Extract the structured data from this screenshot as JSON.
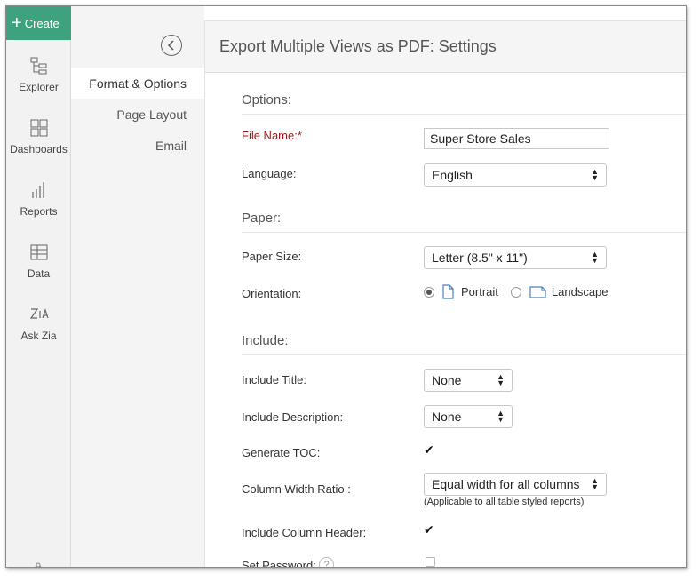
{
  "nav": {
    "create_label": "Create",
    "items": [
      {
        "label": "Explorer",
        "icon": "explorer-icon"
      },
      {
        "label": "Dashboards",
        "icon": "dashboards-icon"
      },
      {
        "label": "Reports",
        "icon": "reports-icon"
      },
      {
        "label": "Data",
        "icon": "data-icon"
      },
      {
        "label": "Ask Zia",
        "icon": "zia-icon"
      }
    ]
  },
  "subnav": {
    "items": [
      {
        "label": "Format & Options",
        "active": true
      },
      {
        "label": "Page Layout",
        "active": false
      },
      {
        "label": "Email",
        "active": false
      }
    ]
  },
  "page": {
    "title": "Export Multiple Views as PDF: Settings"
  },
  "sections": {
    "options": "Options:",
    "paper": "Paper:",
    "include": "Include:"
  },
  "fields": {
    "file_name_label": "File Name:*",
    "file_name_value": "Super Store Sales",
    "language_label": "Language:",
    "language_value": "English",
    "paper_size_label": "Paper Size:",
    "paper_size_value": "Letter (8.5\" x 11\")",
    "orientation_label": "Orientation:",
    "orientation_portrait": "Portrait",
    "orientation_landscape": "Landscape",
    "orientation_selected": "Portrait",
    "include_title_label": "Include Title:",
    "include_title_value": "None",
    "include_description_label": "Include Description:",
    "include_description_value": "None",
    "generate_toc_label": "Generate TOC:",
    "generate_toc_checked": true,
    "column_width_label": "Column Width Ratio :",
    "column_width_value": "Equal width for all columns",
    "column_width_note": "(Applicable to all table styled reports)",
    "include_header_label": "Include Column Header:",
    "include_header_checked": true,
    "set_password_label": "Set Password:",
    "set_password_checked": false,
    "help_glyph": "?"
  },
  "colors": {
    "accent": "#3ea27e",
    "required": "#9b1b1b"
  }
}
